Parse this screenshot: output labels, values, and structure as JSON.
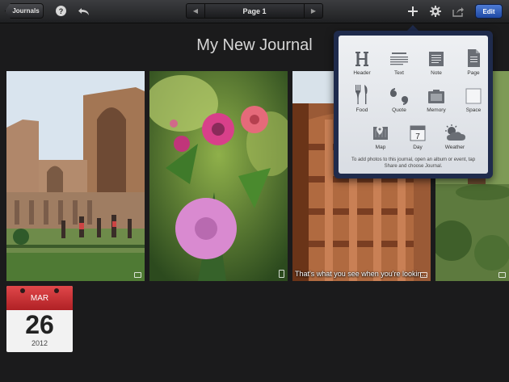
{
  "toolbar": {
    "back_label": "Journals",
    "help_label": "?",
    "page_label": "Page 1",
    "edit_label": "Edit",
    "icons": [
      "undo-icon",
      "add-icon",
      "gear-icon",
      "share-icon"
    ]
  },
  "journal": {
    "title": "My New Journal"
  },
  "photos": [
    {
      "name": "ruins",
      "caption": ""
    },
    {
      "name": "flowers",
      "caption": ""
    },
    {
      "name": "pillar",
      "caption": "That's what you see when you're lookin..."
    },
    {
      "name": "garden",
      "caption": ""
    }
  ],
  "calendar": {
    "month": "MAR",
    "day": "26",
    "year": "2012",
    "accent": "#c8272c"
  },
  "popover": {
    "items": [
      {
        "label": "Header",
        "icon": "header-icon"
      },
      {
        "label": "Text",
        "icon": "text-icon"
      },
      {
        "label": "Note",
        "icon": "note-icon"
      },
      {
        "label": "Page",
        "icon": "page-icon"
      },
      {
        "label": "Food",
        "icon": "food-icon"
      },
      {
        "label": "Quote",
        "icon": "quote-icon"
      },
      {
        "label": "Memory",
        "icon": "memory-icon"
      },
      {
        "label": "Space",
        "icon": "space-icon"
      },
      {
        "label": "Map",
        "icon": "map-icon"
      },
      {
        "label": "Day",
        "icon": "day-icon"
      },
      {
        "label": "Weather",
        "icon": "weather-icon"
      }
    ],
    "day_icon_number": "7",
    "hint": "To add photos to this journal, open an album or event, tap Share and choose Journal."
  },
  "colors": {
    "edit_button": "#2f5fc0",
    "popover_border": "#1f2b4c"
  }
}
